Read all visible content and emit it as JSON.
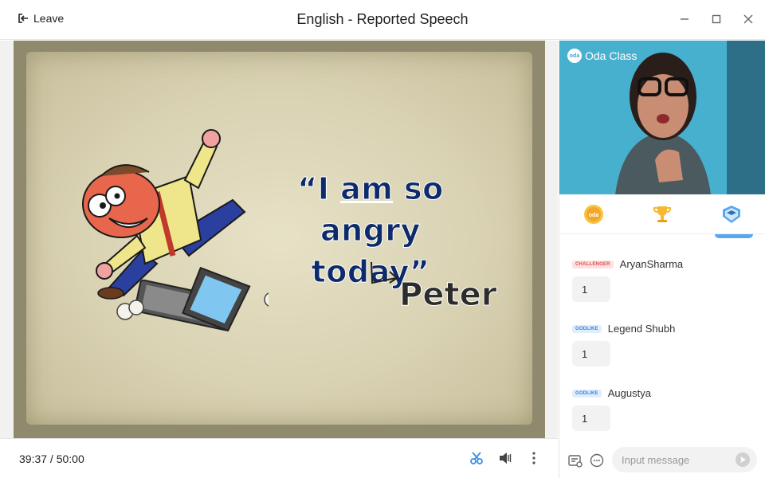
{
  "titlebar": {
    "leave_label": "Leave",
    "title": "English - Reported Speech",
    "controls": [
      "minimize-icon",
      "maximize-icon",
      "close-icon"
    ]
  },
  "slide": {
    "quote_open": "“I ",
    "quote_emph": "am",
    "quote_mid": " so",
    "quote_line2": "angry today”",
    "speaker": "Peter"
  },
  "bottombar": {
    "time_elapsed": "39:37",
    "time_sep": " / ",
    "time_total": "50:00",
    "tools": [
      "scissors-icon",
      "speaker-icon",
      "more-vert-icon"
    ]
  },
  "video": {
    "brand_logo": "oda",
    "brand_name": "Oda Class"
  },
  "tabs": [
    "oda-coin-icon",
    "trophy-icon",
    "class-badge-icon"
  ],
  "chat": {
    "messages": [
      {
        "badge": "CHALLENGER",
        "name": "AryanSharma",
        "text": "1"
      },
      {
        "badge": "GODLIKE",
        "name": "Legend Shubh",
        "text": "1"
      },
      {
        "badge": "GODLIKE",
        "name": "Augustya",
        "text": "1"
      }
    ],
    "input_placeholder": "Input message"
  },
  "colors": {
    "accent": "#5aa8ec",
    "slide_text": "#0d2a6b",
    "challenger": "#d9534f",
    "godlike": "#3b7ed9"
  }
}
